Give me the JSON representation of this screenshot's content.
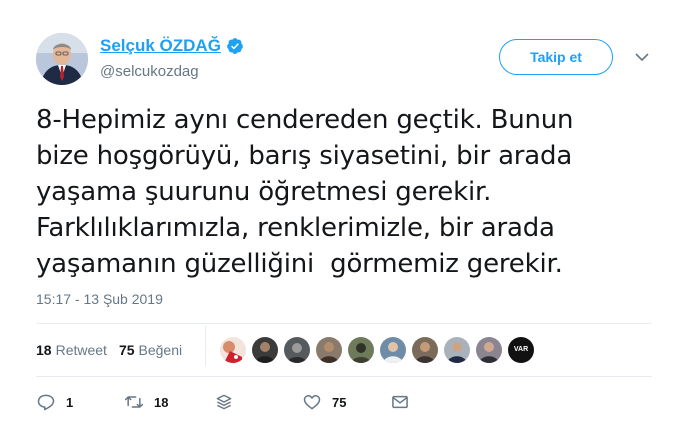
{
  "author": {
    "display_name": "Selçuk ÖZDAĞ",
    "handle": "@selcukozdag",
    "verified": true
  },
  "follow_button_label": "Takip et",
  "tweet": {
    "lines": [
      "8-Hepimiz aynı cendereden geçtik. Bunun",
      "bize hoşgörüyü, barış siyasetini, bir arada",
      "yaşama şuurunu öğretmesi gerekir.",
      "Farklılıklarımızla, renklerimizle, bir arada",
      "yaşamanın güzelliğini  görmemiz gerekir."
    ],
    "timestamp": "15:17 - 13 Şub 2019"
  },
  "stats": {
    "retweet_count": "18",
    "retweet_label": "Retweet",
    "like_count": "75",
    "like_label": "Beğeni"
  },
  "likers": [
    {
      "name": "liker-1",
      "color": "#d98b6c"
    },
    {
      "name": "liker-2",
      "color": "#3b3b3b"
    },
    {
      "name": "liker-3",
      "color": "#555a5e"
    },
    {
      "name": "liker-4",
      "color": "#6b5a4e"
    },
    {
      "name": "liker-5",
      "color": "#4a4f3f"
    },
    {
      "name": "liker-6",
      "color": "#2f4b63"
    },
    {
      "name": "liker-7",
      "color": "#7a6b5a"
    },
    {
      "name": "liker-8",
      "color": "#5a5f66"
    },
    {
      "name": "liker-9",
      "color": "#6e6a70"
    }
  ],
  "last_liker_text": "VAR",
  "actions": {
    "reply_count": "1",
    "retweet_count": "18",
    "like_count": "75"
  },
  "colors": {
    "accent": "#1da1f2",
    "muted": "#657786",
    "text": "#14171a"
  }
}
